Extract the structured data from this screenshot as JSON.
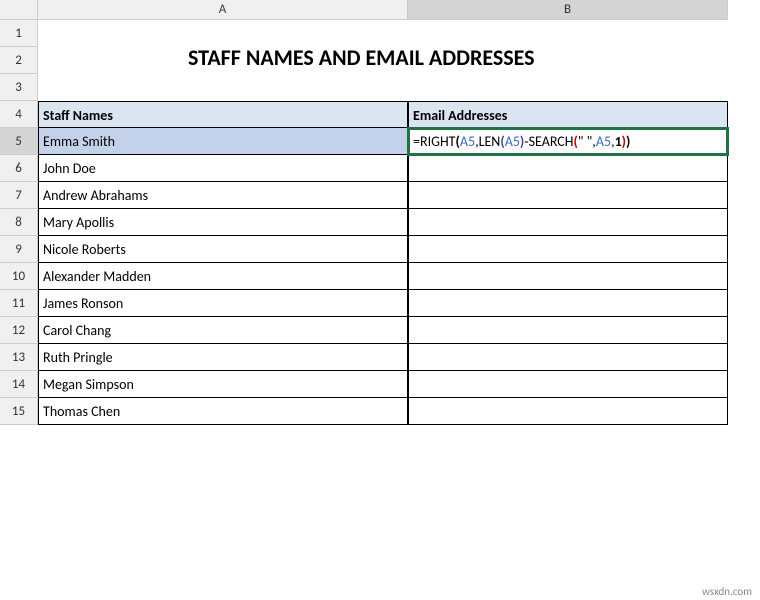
{
  "columns": [
    "A",
    "B"
  ],
  "rows": [
    "1",
    "2",
    "3",
    "4",
    "5",
    "6",
    "7",
    "8",
    "9",
    "10",
    "11",
    "12",
    "13",
    "14",
    "15"
  ],
  "title": "STAFF NAMES AND EMAIL ADDRESSES",
  "headers": {
    "A4": "Staff Names",
    "B4": "Email Addresses"
  },
  "names": {
    "A5": "Emma Smith",
    "A6": "John Doe",
    "A7": "Andrew Abrahams",
    "A8": "Mary Apollis",
    "A9": "Nicole Roberts",
    "A10": "Alexander Madden",
    "A11": "James Ronson",
    "A12": "Carol Chang",
    "A13": "Ruth Pringle",
    "A14": "Megan Simpson",
    "A15": "Thomas Chen"
  },
  "formula": {
    "prefix": "=",
    "fn_right": "RIGHT",
    "ref_a5": "A5",
    "comma": ",",
    "fn_len": "LEN",
    "minus": "-",
    "fn_search": "SEARCH",
    "quote_space": "\" \"",
    "one": "1",
    "open": "(",
    "close": ")"
  },
  "watermark": "wsxdn.com",
  "active_cell": "B5"
}
